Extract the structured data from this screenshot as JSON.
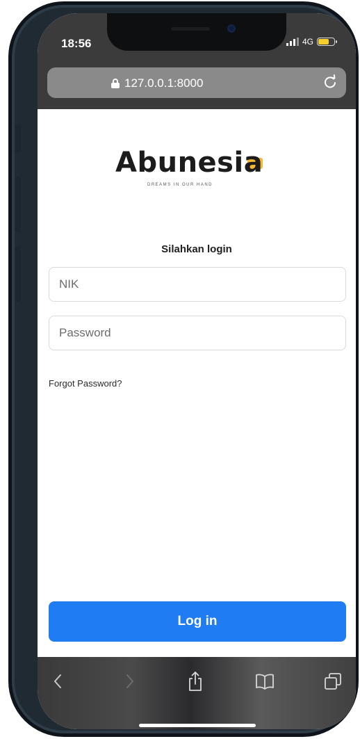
{
  "status_bar": {
    "time": "18:56",
    "network": "4G",
    "battery_level": 0.6,
    "icons": [
      "signal-icon",
      "battery-icon"
    ]
  },
  "browser": {
    "url": "127.0.0.1:8000",
    "icons": [
      "lock-icon",
      "reload-icon"
    ]
  },
  "logo": {
    "name": "Abunesia",
    "tagline": "DREAMS IN OUR HAND",
    "accent_color": "#f5b82e"
  },
  "login": {
    "heading": "Silahkan login",
    "nik_placeholder": "NIK",
    "nik_value": "",
    "password_placeholder": "Password",
    "password_value": "",
    "forgot_label": "Forgot Password?",
    "submit_label": "Log in",
    "button_color": "#1f7cf3"
  },
  "toolbar": {
    "icons": [
      "back-icon",
      "forward-icon",
      "share-icon",
      "bookmarks-icon",
      "tabs-icon"
    ]
  }
}
